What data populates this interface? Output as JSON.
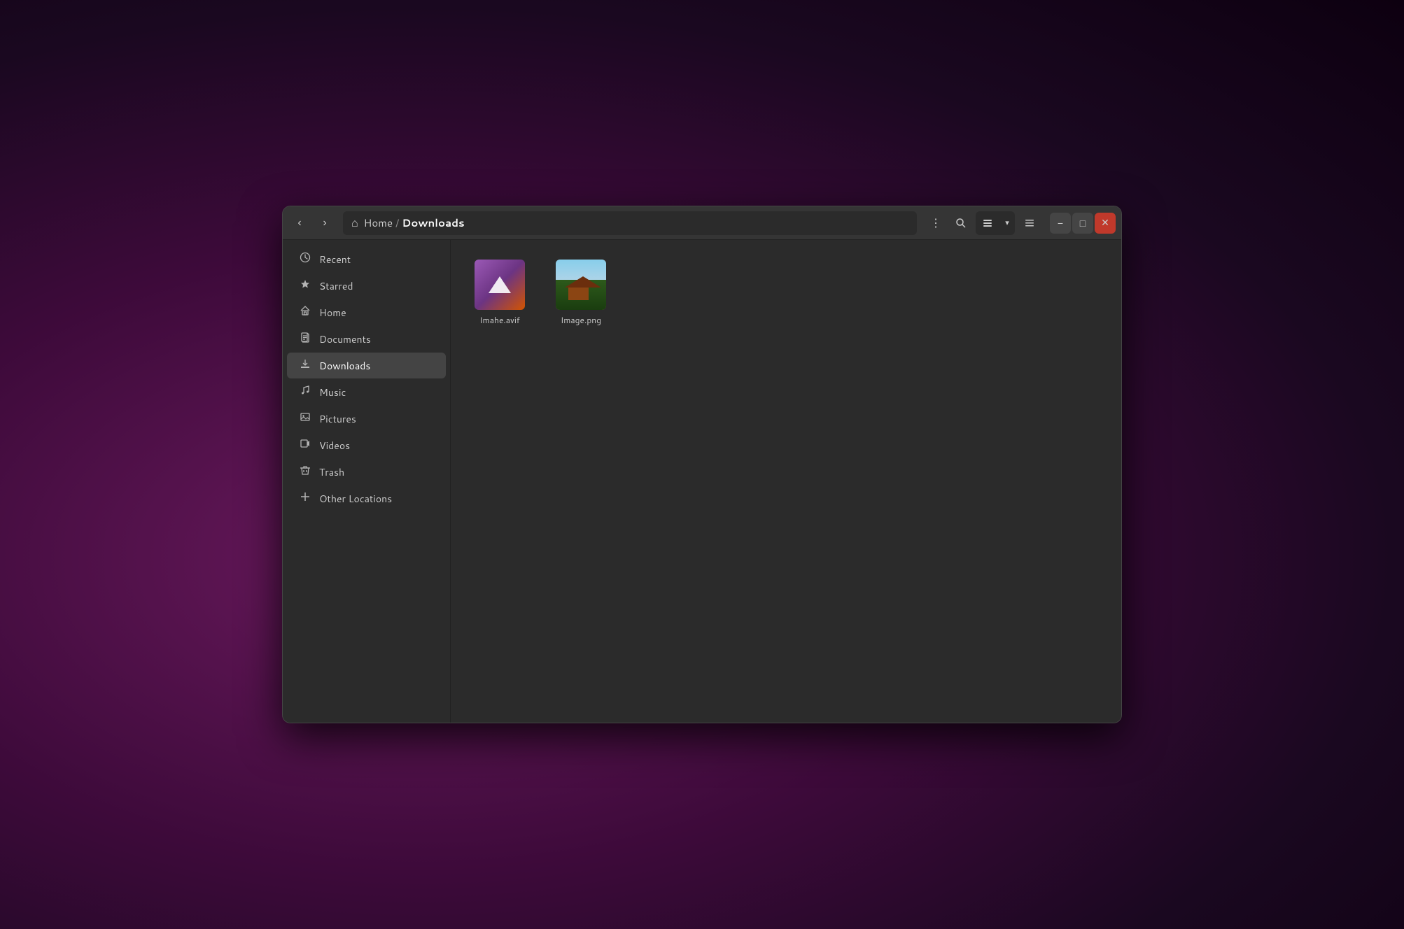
{
  "window": {
    "title": "Downloads"
  },
  "titlebar": {
    "back_label": "‹",
    "forward_label": "›",
    "breadcrumb": {
      "home_icon": "⌂",
      "home_label": "Home",
      "separator": "/",
      "current": "Downloads"
    },
    "menu_icon": "⋮",
    "search_icon": "🔍",
    "view_list_icon": "≡",
    "view_chevron": "▾",
    "hamburger_icon": "☰",
    "minimize_icon": "−",
    "maximize_icon": "□",
    "close_icon": "✕"
  },
  "sidebar": {
    "items": [
      {
        "id": "recent",
        "icon": "🕐",
        "label": "Recent"
      },
      {
        "id": "starred",
        "icon": "★",
        "label": "Starred"
      },
      {
        "id": "home",
        "icon": "⌂",
        "label": "Home"
      },
      {
        "id": "documents",
        "icon": "📄",
        "label": "Documents"
      },
      {
        "id": "downloads",
        "icon": "⬇",
        "label": "Downloads"
      },
      {
        "id": "music",
        "icon": "♪",
        "label": "Music"
      },
      {
        "id": "pictures",
        "icon": "🖼",
        "label": "Pictures"
      },
      {
        "id": "videos",
        "icon": "🎞",
        "label": "Videos"
      },
      {
        "id": "trash",
        "icon": "🗑",
        "label": "Trash"
      },
      {
        "id": "other-locations",
        "icon": "+",
        "label": "Other Locations"
      }
    ]
  },
  "files": [
    {
      "id": "imahe-avif",
      "name": "Imahe.avif",
      "type": "avif"
    },
    {
      "id": "image-png",
      "name": "Image.png",
      "type": "png"
    }
  ]
}
